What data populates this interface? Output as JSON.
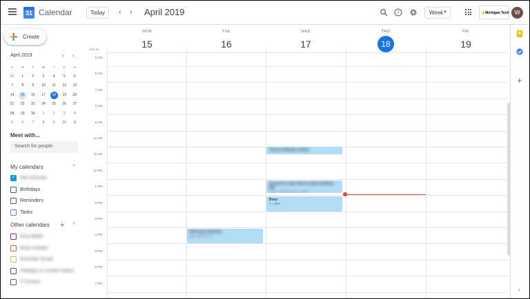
{
  "header": {
    "app_title": "Calendar",
    "logo_number": "31",
    "today_label": "Today",
    "month_title": "April 2019",
    "view_label": "Week",
    "org_name": "Michigan",
    "org_name2": "Tech",
    "avatar_letter": "W"
  },
  "sidebar": {
    "create_label": "Create",
    "mini_month": "April 2019",
    "weekday_heads": [
      "S",
      "M",
      "T",
      "W",
      "T",
      "F",
      "S"
    ],
    "weeks": [
      [
        "31",
        "1",
        "2",
        "3",
        "4",
        "5",
        "6"
      ],
      [
        "7",
        "8",
        "9",
        "10",
        "11",
        "12",
        "13"
      ],
      [
        "14",
        "15",
        "16",
        "17",
        "18",
        "19",
        "20"
      ],
      [
        "21",
        "22",
        "23",
        "24",
        "25",
        "26",
        "27"
      ],
      [
        "28",
        "29",
        "30",
        "1",
        "2",
        "3",
        "4"
      ],
      [
        "5",
        "6",
        "7",
        "8",
        "9",
        "10",
        "11"
      ]
    ],
    "meet_title": "Meet with...",
    "search_placeholder": "Search for people",
    "my_calendars_title": "My calendars",
    "my_calendars": [
      {
        "label": "Will Schmidt",
        "color": "#039be5",
        "checked": true
      },
      {
        "label": "Birthdays",
        "color": "#0b8043",
        "checked": false
      },
      {
        "label": "Reminders",
        "color": "#3f51b5",
        "checked": false
      },
      {
        "label": "Tasks",
        "color": "#4285f4",
        "checked": false
      }
    ],
    "other_calendars_title": "Other calendars",
    "other_calendars": [
      {
        "label": "Amy Bilder",
        "color": "#8e24aa"
      },
      {
        "label": "Brian Hodder",
        "color": "#f4511e"
      },
      {
        "label": "Extender Email",
        "color": "#c0ca33"
      },
      {
        "label": "Holidays in United States",
        "color": "#0b8043"
      },
      {
        "label": "IT Events",
        "color": "#616161"
      }
    ]
  },
  "grid": {
    "timezone": "GMT-04",
    "days": [
      {
        "dow": "MON",
        "num": "15",
        "today": false
      },
      {
        "dow": "TUE",
        "num": "16",
        "today": false
      },
      {
        "dow": "WED",
        "num": "17",
        "today": false
      },
      {
        "dow": "THU",
        "num": "18",
        "today": true
      },
      {
        "dow": "FRI",
        "num": "19",
        "today": false
      }
    ],
    "hours": [
      "5 AM",
      "6 AM",
      "7 AM",
      "8 AM",
      "9 AM",
      "10 AM",
      "11 AM",
      "12 PM",
      "1 PM",
      "2 PM",
      "3 PM",
      "4 PM",
      "5 PM",
      "6 PM",
      "7 PM"
    ],
    "events": [
      {
        "title": "Telecom Weekly, 3:30am",
        "time": "",
        "blurred": true
      },
      {
        "title": "Scared At Large: Boot to Bean Stuffing, RM",
        "time": "12pm, 4000 Student Lounge",
        "blurred": true
      },
      {
        "title": "Busy",
        "time": "1 – 2pm",
        "blurred": false
      },
      {
        "title": "Will Rudes Meeting",
        "time": "3pm, EERC 227",
        "blurred": true
      }
    ]
  },
  "colors": {
    "accent": "#1a73e8",
    "event_bg": "#b3dcf6",
    "now_line": "#ea4335"
  }
}
